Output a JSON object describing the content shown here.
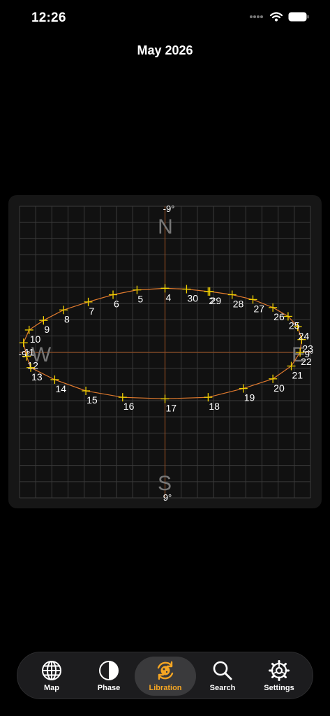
{
  "status_bar": {
    "time": "12:26"
  },
  "header": {
    "title": "May 2026"
  },
  "colors": {
    "accent": "#f5a623",
    "curve": "#e07a2e",
    "marker": "#f2d200",
    "grid": "#3a3a3a",
    "axis": "#8a4a22"
  },
  "compass": {
    "north": "N",
    "south": "S",
    "east": "E",
    "west": "W"
  },
  "chart_data": {
    "type": "scatter",
    "title": "",
    "xlabel": "",
    "ylabel": "",
    "xlim": [
      -9,
      9
    ],
    "ylim": [
      -9,
      9
    ],
    "grid": true,
    "tick_labels": {
      "top": "-9°",
      "bottom": "9°",
      "left": "-9°",
      "right": "9°"
    },
    "points": [
      {
        "label": "2",
        "x": 5.4,
        "y": -7.6
      },
      {
        "label": "4",
        "x": 0.0,
        "y": -8.0
      },
      {
        "label": "5",
        "x": -3.5,
        "y": -7.8
      },
      {
        "label": "6",
        "x": -6.5,
        "y": -7.2
      },
      {
        "label": "7",
        "x": -9.6,
        "y": -6.3
      },
      {
        "label": "8",
        "x": -12.7,
        "y": -5.3
      },
      {
        "label": "9",
        "x": -15.2,
        "y": -4.0
      },
      {
        "label": "10",
        "x": -17.0,
        "y": -2.8
      },
      {
        "label": "11",
        "x": -17.7,
        "y": -1.2
      },
      {
        "label": "12",
        "x": -17.3,
        "y": 0.5
      },
      {
        "label": "13",
        "x": -16.8,
        "y": 1.9
      },
      {
        "label": "14",
        "x": -13.8,
        "y": 3.4
      },
      {
        "label": "15",
        "x": -9.9,
        "y": 4.8
      },
      {
        "label": "16",
        "x": -5.3,
        "y": 5.6
      },
      {
        "label": "17",
        "x": 0.0,
        "y": 5.8
      },
      {
        "label": "18",
        "x": 5.4,
        "y": 5.6
      },
      {
        "label": "19",
        "x": 9.8,
        "y": 4.5
      },
      {
        "label": "20",
        "x": 13.5,
        "y": 3.3
      },
      {
        "label": "21",
        "x": 15.8,
        "y": 1.7
      },
      {
        "label": "22",
        "x": 16.9,
        "y": 0.0
      },
      {
        "label": "23",
        "x": 17.1,
        "y": -1.6
      },
      {
        "label": "24",
        "x": 16.6,
        "y": -3.2
      },
      {
        "label": "25",
        "x": 15.4,
        "y": -4.5
      },
      {
        "label": "26",
        "x": 13.5,
        "y": -5.6
      },
      {
        "label": "27",
        "x": 11.0,
        "y": -6.6
      },
      {
        "label": "28",
        "x": 8.4,
        "y": -7.2
      },
      {
        "label": "29",
        "x": 5.6,
        "y": -7.6
      },
      {
        "label": "30",
        "x": 2.7,
        "y": -7.9
      }
    ]
  },
  "tab_bar": {
    "tabs": [
      {
        "key": "map",
        "label": "Map",
        "icon": "globe-icon",
        "active": false
      },
      {
        "key": "phase",
        "label": "Phase",
        "icon": "half-moon-icon",
        "active": false
      },
      {
        "key": "libration",
        "label": "Libration",
        "icon": "libration-icon",
        "active": true
      },
      {
        "key": "search",
        "label": "Search",
        "icon": "magnifier-icon",
        "active": false
      },
      {
        "key": "settings",
        "label": "Settings",
        "icon": "gear-icon",
        "active": false
      }
    ]
  }
}
